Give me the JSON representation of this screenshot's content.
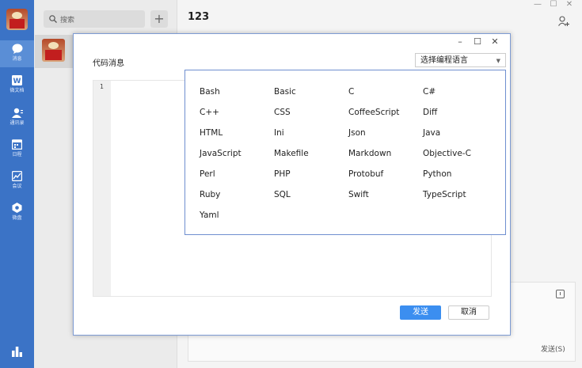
{
  "sidebar": {
    "items": [
      {
        "label": "消息",
        "icon": "chat-bubble-icon"
      },
      {
        "label": "微文档",
        "icon": "document-icon"
      },
      {
        "label": "通讯录",
        "icon": "contacts-icon"
      },
      {
        "label": "日程",
        "icon": "calendar-icon"
      },
      {
        "label": "会议",
        "icon": "meeting-icon"
      },
      {
        "label": "微盘",
        "icon": "drive-icon"
      }
    ]
  },
  "search": {
    "placeholder": "搜索"
  },
  "chat": {
    "title": "123",
    "send_label": "发送(S)"
  },
  "dialog": {
    "title": "代码消息",
    "language_select": "选择编程语言",
    "line_number": "1",
    "send_label": "发送",
    "cancel_label": "取消"
  },
  "languages": [
    "Bash",
    "Basic",
    "C",
    "C#",
    "C++",
    "CSS",
    "CoffeeScript",
    "Diff",
    "HTML",
    "Ini",
    "Json",
    "Java",
    "JavaScript",
    "Makefile",
    "Markdown",
    "Objective-C",
    "Perl",
    "PHP",
    "Protobuf",
    "Python",
    "Ruby",
    "SQL",
    "Swift",
    "TypeScript",
    "Yaml"
  ],
  "colors": {
    "rail": "#3b73c6",
    "primary": "#3b8ef0",
    "panel_border": "#6f8fd0"
  }
}
